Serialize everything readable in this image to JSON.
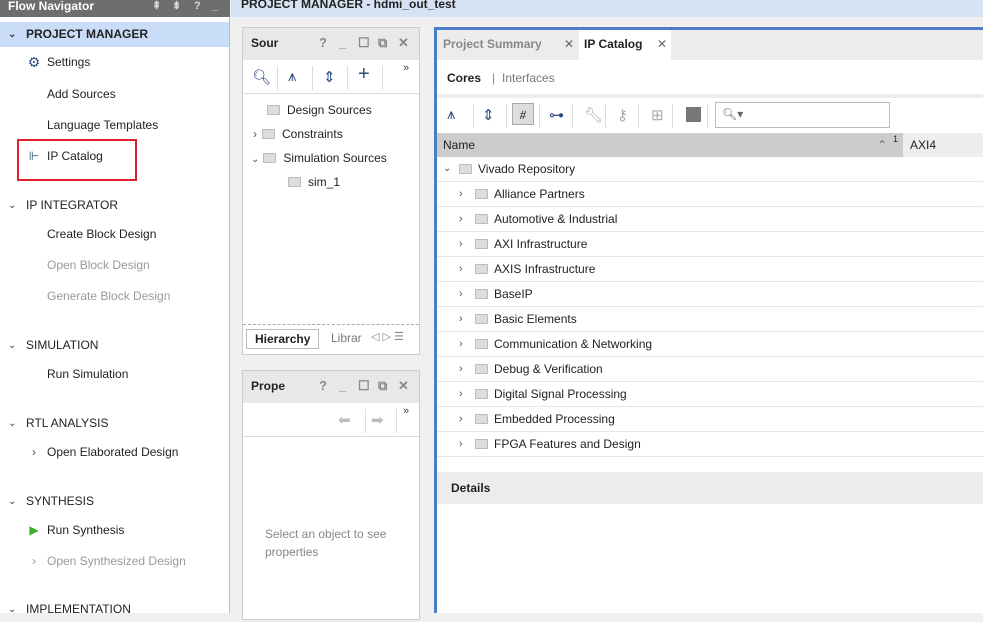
{
  "nav": {
    "title": "Flow Navigator",
    "sections": [
      {
        "label": "PROJECT MANAGER",
        "items": [
          {
            "label": "Settings",
            "icon": "gear-icon"
          },
          {
            "label": "Add Sources"
          },
          {
            "label": "Language Templates"
          },
          {
            "label": "IP Catalog",
            "icon": "ip-chip-icon",
            "highlighted": true
          }
        ]
      },
      {
        "label": "IP INTEGRATOR",
        "items": [
          {
            "label": "Create Block Design"
          },
          {
            "label": "Open Block Design",
            "disabled": true
          },
          {
            "label": "Generate Block Design",
            "disabled": true
          }
        ]
      },
      {
        "label": "SIMULATION",
        "items": [
          {
            "label": "Run Simulation"
          }
        ]
      },
      {
        "label": "RTL ANALYSIS",
        "items": [
          {
            "label": "Open Elaborated Design"
          }
        ]
      },
      {
        "label": "SYNTHESIS",
        "items": [
          {
            "label": "Run Synthesis",
            "icon": "play-icon"
          },
          {
            "label": "Open Synthesized Design",
            "disabled": true
          }
        ]
      },
      {
        "label": "IMPLEMENTATION",
        "items": []
      }
    ]
  },
  "topbar": {
    "title": "PROJECT MANAGER - hdmi_out_test"
  },
  "sources": {
    "title": "Sour",
    "tree": [
      "Design Sources",
      "Constraints",
      "Simulation Sources",
      "sim_1"
    ],
    "tabs": [
      "Hierarchy",
      "Librar"
    ]
  },
  "properties": {
    "title": "Prope",
    "empty_text": "Select an object to see properties"
  },
  "main": {
    "tabs": [
      "Project Summary",
      "IP Catalog"
    ],
    "subtabs": [
      "Cores",
      "Interfaces"
    ],
    "search_placeholder": "",
    "columns": [
      "Name",
      "AXI4"
    ],
    "sort_indicator": "1",
    "root": "Vivado Repository",
    "categories": [
      "Alliance Partners",
      "Automotive & Industrial",
      "AXI Infrastructure",
      "AXIS Infrastructure",
      "BaseIP",
      "Basic Elements",
      "Communication & Networking",
      "Debug & Verification",
      "Digital Signal Processing",
      "Embedded Processing",
      "FPGA Features and Design"
    ],
    "details_title": "Details"
  },
  "colors": {
    "accent": "#4a7cca",
    "highlight": "#c9ddf8",
    "annotation": "#e0202a"
  }
}
